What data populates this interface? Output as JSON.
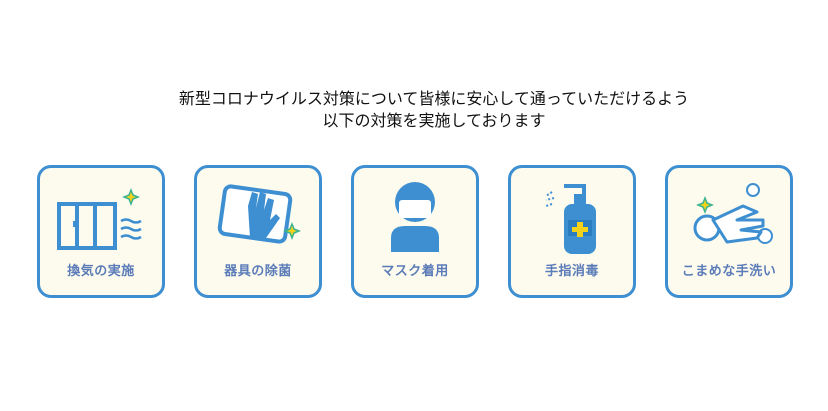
{
  "heading": {
    "line1": "新型コロナウイルス対策について皆様に安心して通っていただけるよう",
    "line2": "以下の対策を実施しております"
  },
  "measures": [
    {
      "label": "換気の実施",
      "icon": "window-ventilation-icon"
    },
    {
      "label": "器具の除菌",
      "icon": "hand-wiping-icon"
    },
    {
      "label": "マスク着用",
      "icon": "person-mask-icon"
    },
    {
      "label": "手指消毒",
      "icon": "sanitizer-bottle-icon"
    },
    {
      "label": "こまめな手洗い",
      "icon": "hand-washing-icon"
    }
  ],
  "colors": {
    "border": "#3d8fd1",
    "icon": "#3d8fd1",
    "label": "#5b7cb8",
    "card_bg": "#fdfbee",
    "sparkle": "#3bb38f",
    "cross": "#f2d21b"
  }
}
